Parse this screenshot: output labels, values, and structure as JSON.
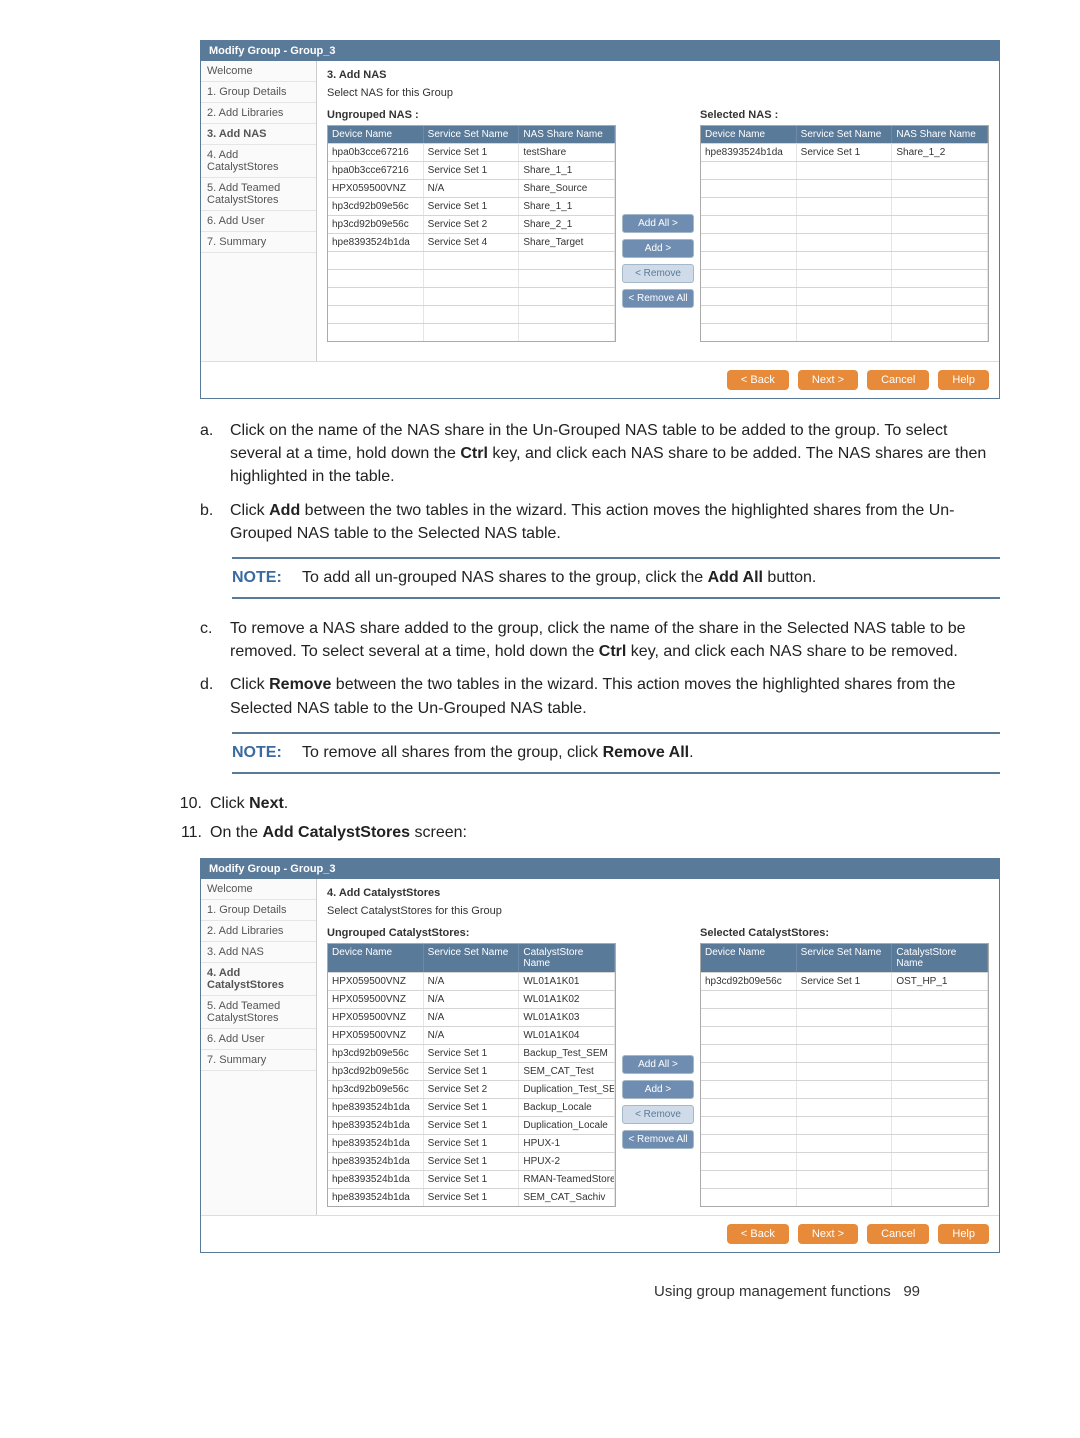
{
  "wiz1": {
    "title": "Modify Group - Group_3",
    "side": [
      "Welcome",
      "1. Group Details",
      "2. Add Libraries",
      "3. Add NAS",
      "4. Add CatalystStores",
      "5. Add Teamed CatalystStores",
      "6. Add User",
      "7. Summary"
    ],
    "sideCurrent": 3,
    "step": "3. Add NAS",
    "subtitle": "Select NAS for this Group",
    "leftHeading": "Ungrouped NAS :",
    "rightHeading": "Selected NAS :",
    "cols": [
      "Device Name",
      "Service Set Name",
      "NAS Share Name"
    ],
    "left": [
      [
        "hpa0b3cce67216",
        "Service Set 1",
        "testShare"
      ],
      [
        "hpa0b3cce67216",
        "Service Set 1",
        "Share_1_1"
      ],
      [
        "HPX059500VNZ",
        "N/A",
        "Share_Source"
      ],
      [
        "hp3cd92b09e56c",
        "Service Set 1",
        "Share_1_1"
      ],
      [
        "hp3cd92b09e56c",
        "Service Set 2",
        "Share_2_1"
      ],
      [
        "hpe8393524b1da",
        "Service Set 4",
        "Share_Target"
      ]
    ],
    "leftEmpty": 5,
    "right": [
      [
        "hpe8393524b1da",
        "Service Set 1",
        "Share_1_2"
      ]
    ],
    "rightEmpty": 10
  },
  "midBtns": {
    "addAll": "Add All >",
    "add": "Add >",
    "remove": "< Remove",
    "removeAll": "< Remove All"
  },
  "footBtns": {
    "back": "< Back",
    "next": "Next >",
    "cancel": "Cancel",
    "help": "Help"
  },
  "instrA": {
    "a": {
      "mk": "a.",
      "t1": "Click on the name of the NAS share in the Un-Grouped NAS table to be added to the group. To select several at a time, hold down the ",
      "b1": "Ctrl",
      "t2": " key, and click each NAS share to be added. The NAS shares are then highlighted in the table."
    },
    "b": {
      "mk": "b.",
      "t1": "Click ",
      "b1": "Add",
      "t2": " between the two tables in the wizard. This action moves the highlighted shares from the Un-Grouped NAS table to the Selected NAS table."
    }
  },
  "note1": {
    "label": "NOTE:",
    "t1": "To add all un-grouped NAS shares to the group, click the ",
    "b1": "Add All",
    "t2": " button."
  },
  "instrB": {
    "c": {
      "mk": "c.",
      "t1": "To remove a NAS share added to the group, click the name of the share in the Selected NAS table to be removed. To select several at a time, hold down the ",
      "b1": "Ctrl",
      "t2": " key, and click each NAS share to be removed."
    },
    "d": {
      "mk": "d.",
      "t1": "Click ",
      "b1": "Remove",
      "t2": " between the two tables in the wizard. This action moves the highlighted shares from the Selected NAS table to the Un-Grouped NAS table."
    }
  },
  "note2": {
    "label": "NOTE:",
    "t1": "To remove all shares from the group, click ",
    "b1": "Remove All",
    "t2": "."
  },
  "steps": {
    "10": {
      "mk": "10.",
      "t1": "Click ",
      "b1": "Next",
      "t2": "."
    },
    "11": {
      "mk": "11.",
      "t1": "On the ",
      "b1": "Add CatalystStores",
      "t2": " screen:"
    }
  },
  "wiz2": {
    "title": "Modify Group - Group_3",
    "side": [
      "Welcome",
      "1. Group Details",
      "2. Add Libraries",
      "3. Add NAS",
      "4. Add CatalystStores",
      "5. Add Teamed CatalystStores",
      "6. Add User",
      "7. Summary"
    ],
    "sideCurrent": 4,
    "step": "4. Add CatalystStores",
    "subtitle": "Select CatalystStores for this Group",
    "leftHeading": "Ungrouped CatalystStores:",
    "rightHeading": "Selected CatalystStores:",
    "cols": [
      "Device Name",
      "Service Set Name",
      "CatalystStore Name"
    ],
    "left": [
      [
        "HPX059500VNZ",
        "N/A",
        "WL01A1K01"
      ],
      [
        "HPX059500VNZ",
        "N/A",
        "WL01A1K02"
      ],
      [
        "HPX059500VNZ",
        "N/A",
        "WL01A1K03"
      ],
      [
        "HPX059500VNZ",
        "N/A",
        "WL01A1K04"
      ],
      [
        "hp3cd92b09e56c",
        "Service Set 1",
        "Backup_Test_SEM"
      ],
      [
        "hp3cd92b09e56c",
        "Service Set 1",
        "SEM_CAT_Test"
      ],
      [
        "hp3cd92b09e56c",
        "Service Set 2",
        "Duplication_Test_SEM"
      ],
      [
        "hpe8393524b1da",
        "Service Set 1",
        "Backup_Locale"
      ],
      [
        "hpe8393524b1da",
        "Service Set 1",
        "Duplication_Locale"
      ],
      [
        "hpe8393524b1da",
        "Service Set 1",
        "HPUX-1"
      ],
      [
        "hpe8393524b1da",
        "Service Set 1",
        "HPUX-2"
      ],
      [
        "hpe8393524b1da",
        "Service Set 1",
        "RMAN-TeamedStore"
      ],
      [
        "hpe8393524b1da",
        "Service Set 1",
        "SEM_CAT_Sachiv"
      ]
    ],
    "leftEmpty": 0,
    "right": [
      [
        "hp3cd92b09e56c",
        "Service Set 1",
        "OST_HP_1"
      ]
    ],
    "rightEmpty": 12
  },
  "footer": {
    "text": "Using group management functions",
    "page": "99"
  }
}
